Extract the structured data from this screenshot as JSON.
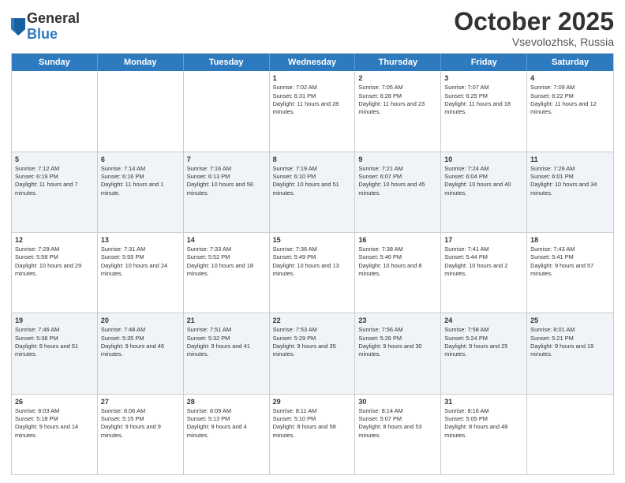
{
  "logo": {
    "general": "General",
    "blue": "Blue"
  },
  "header": {
    "month": "October 2025",
    "location": "Vsevolozhsk, Russia"
  },
  "weekdays": [
    "Sunday",
    "Monday",
    "Tuesday",
    "Wednesday",
    "Thursday",
    "Friday",
    "Saturday"
  ],
  "rows": [
    [
      {
        "date": "",
        "sunrise": "",
        "sunset": "",
        "daylight": ""
      },
      {
        "date": "",
        "sunrise": "",
        "sunset": "",
        "daylight": ""
      },
      {
        "date": "",
        "sunrise": "",
        "sunset": "",
        "daylight": ""
      },
      {
        "date": "1",
        "sunrise": "Sunrise: 7:02 AM",
        "sunset": "Sunset: 6:31 PM",
        "daylight": "Daylight: 11 hours and 28 minutes."
      },
      {
        "date": "2",
        "sunrise": "Sunrise: 7:05 AM",
        "sunset": "Sunset: 6:28 PM",
        "daylight": "Daylight: 11 hours and 23 minutes."
      },
      {
        "date": "3",
        "sunrise": "Sunrise: 7:07 AM",
        "sunset": "Sunset: 6:25 PM",
        "daylight": "Daylight: 11 hours and 18 minutes."
      },
      {
        "date": "4",
        "sunrise": "Sunrise: 7:09 AM",
        "sunset": "Sunset: 6:22 PM",
        "daylight": "Daylight: 11 hours and 12 minutes."
      }
    ],
    [
      {
        "date": "5",
        "sunrise": "Sunrise: 7:12 AM",
        "sunset": "Sunset: 6:19 PM",
        "daylight": "Daylight: 11 hours and 7 minutes."
      },
      {
        "date": "6",
        "sunrise": "Sunrise: 7:14 AM",
        "sunset": "Sunset: 6:16 PM",
        "daylight": "Daylight: 11 hours and 1 minute."
      },
      {
        "date": "7",
        "sunrise": "Sunrise: 7:16 AM",
        "sunset": "Sunset: 6:13 PM",
        "daylight": "Daylight: 10 hours and 56 minutes."
      },
      {
        "date": "8",
        "sunrise": "Sunrise: 7:19 AM",
        "sunset": "Sunset: 6:10 PM",
        "daylight": "Daylight: 10 hours and 51 minutes."
      },
      {
        "date": "9",
        "sunrise": "Sunrise: 7:21 AM",
        "sunset": "Sunset: 6:07 PM",
        "daylight": "Daylight: 10 hours and 45 minutes."
      },
      {
        "date": "10",
        "sunrise": "Sunrise: 7:24 AM",
        "sunset": "Sunset: 6:04 PM",
        "daylight": "Daylight: 10 hours and 40 minutes."
      },
      {
        "date": "11",
        "sunrise": "Sunrise: 7:26 AM",
        "sunset": "Sunset: 6:01 PM",
        "daylight": "Daylight: 10 hours and 34 minutes."
      }
    ],
    [
      {
        "date": "12",
        "sunrise": "Sunrise: 7:29 AM",
        "sunset": "Sunset: 5:58 PM",
        "daylight": "Daylight: 10 hours and 29 minutes."
      },
      {
        "date": "13",
        "sunrise": "Sunrise: 7:31 AM",
        "sunset": "Sunset: 5:55 PM",
        "daylight": "Daylight: 10 hours and 24 minutes."
      },
      {
        "date": "14",
        "sunrise": "Sunrise: 7:33 AM",
        "sunset": "Sunset: 5:52 PM",
        "daylight": "Daylight: 10 hours and 18 minutes."
      },
      {
        "date": "15",
        "sunrise": "Sunrise: 7:36 AM",
        "sunset": "Sunset: 5:49 PM",
        "daylight": "Daylight: 10 hours and 13 minutes."
      },
      {
        "date": "16",
        "sunrise": "Sunrise: 7:38 AM",
        "sunset": "Sunset: 5:46 PM",
        "daylight": "Daylight: 10 hours and 8 minutes."
      },
      {
        "date": "17",
        "sunrise": "Sunrise: 7:41 AM",
        "sunset": "Sunset: 5:44 PM",
        "daylight": "Daylight: 10 hours and 2 minutes."
      },
      {
        "date": "18",
        "sunrise": "Sunrise: 7:43 AM",
        "sunset": "Sunset: 5:41 PM",
        "daylight": "Daylight: 9 hours and 57 minutes."
      }
    ],
    [
      {
        "date": "19",
        "sunrise": "Sunrise: 7:46 AM",
        "sunset": "Sunset: 5:38 PM",
        "daylight": "Daylight: 9 hours and 51 minutes."
      },
      {
        "date": "20",
        "sunrise": "Sunrise: 7:48 AM",
        "sunset": "Sunset: 5:35 PM",
        "daylight": "Daylight: 9 hours and 46 minutes."
      },
      {
        "date": "21",
        "sunrise": "Sunrise: 7:51 AM",
        "sunset": "Sunset: 5:32 PM",
        "daylight": "Daylight: 9 hours and 41 minutes."
      },
      {
        "date": "22",
        "sunrise": "Sunrise: 7:53 AM",
        "sunset": "Sunset: 5:29 PM",
        "daylight": "Daylight: 9 hours and 35 minutes."
      },
      {
        "date": "23",
        "sunrise": "Sunrise: 7:56 AM",
        "sunset": "Sunset: 5:26 PM",
        "daylight": "Daylight: 9 hours and 30 minutes."
      },
      {
        "date": "24",
        "sunrise": "Sunrise: 7:58 AM",
        "sunset": "Sunset: 5:24 PM",
        "daylight": "Daylight: 9 hours and 25 minutes."
      },
      {
        "date": "25",
        "sunrise": "Sunrise: 8:01 AM",
        "sunset": "Sunset: 5:21 PM",
        "daylight": "Daylight: 9 hours and 19 minutes."
      }
    ],
    [
      {
        "date": "26",
        "sunrise": "Sunrise: 8:03 AM",
        "sunset": "Sunset: 5:18 PM",
        "daylight": "Daylight: 9 hours and 14 minutes."
      },
      {
        "date": "27",
        "sunrise": "Sunrise: 8:06 AM",
        "sunset": "Sunset: 5:15 PM",
        "daylight": "Daylight: 9 hours and 9 minutes."
      },
      {
        "date": "28",
        "sunrise": "Sunrise: 8:09 AM",
        "sunset": "Sunset: 5:13 PM",
        "daylight": "Daylight: 9 hours and 4 minutes."
      },
      {
        "date": "29",
        "sunrise": "Sunrise: 8:11 AM",
        "sunset": "Sunset: 5:10 PM",
        "daylight": "Daylight: 8 hours and 58 minutes."
      },
      {
        "date": "30",
        "sunrise": "Sunrise: 8:14 AM",
        "sunset": "Sunset: 5:07 PM",
        "daylight": "Daylight: 8 hours and 53 minutes."
      },
      {
        "date": "31",
        "sunrise": "Sunrise: 8:16 AM",
        "sunset": "Sunset: 5:05 PM",
        "daylight": "Daylight: 8 hours and 48 minutes."
      },
      {
        "date": "",
        "sunrise": "",
        "sunset": "",
        "daylight": ""
      }
    ]
  ]
}
